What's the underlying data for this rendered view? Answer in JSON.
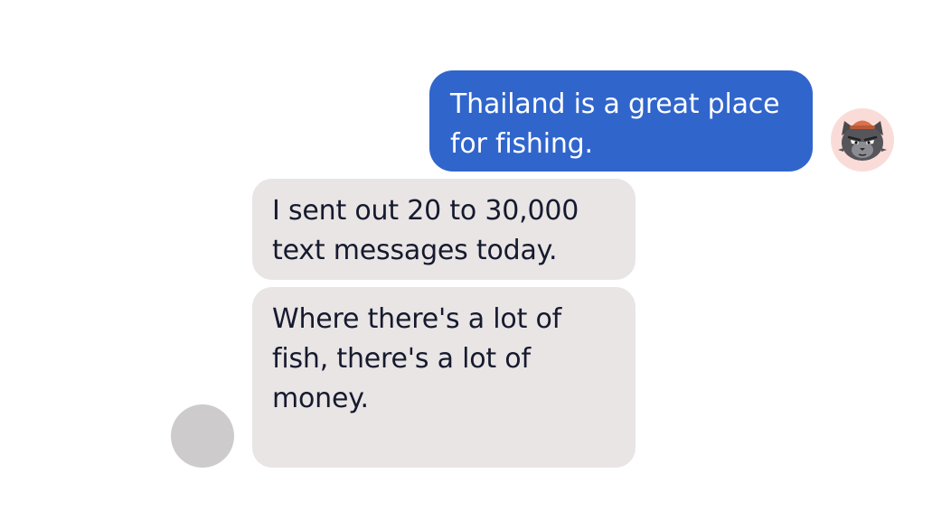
{
  "conversation": {
    "messages": [
      {
        "sender": "self",
        "text": "Thailand is a great place\nfor fishing."
      },
      {
        "sender": "contact",
        "text": "I sent out 20 to 30,000\ntext messages today."
      },
      {
        "sender": "contact",
        "text": "Where there's a lot of\nfish, there's a lot of\nmoney."
      }
    ],
    "self_avatar": {
      "icon": "cat-avatar-icon"
    },
    "contact_avatar": {
      "icon": "avatar-placeholder"
    }
  },
  "colors": {
    "outgoing_bubble": "#3065cb",
    "incoming_bubble": "#e9e5e5",
    "incoming_text": "#161a2e",
    "self_avatar_bg": "#f9dcd8",
    "contact_avatar_bg": "#cecbcc"
  }
}
